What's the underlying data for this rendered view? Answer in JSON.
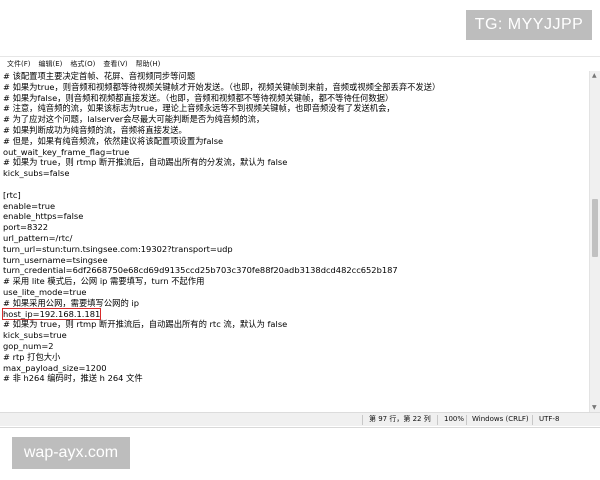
{
  "watermarks": {
    "top": "TG: MYYJJPP",
    "bottom": "wap-ayx.com"
  },
  "menu": [
    "文件(F)",
    "编辑(E)",
    "格式(O)",
    "查看(V)",
    "帮助(H)"
  ],
  "lines": [
    "# 该配置项主要决定首帧、花屏、音视频同步等问题",
    "# 如果为true，则音频和视频都等待视频关键帧才开始发送。（也即，视频关键帧到来前，音频或视频全部丢弃不发送）",
    "# 如果为false，则音频和视频都直接发送。（也即，音频和视频都不等待视频关键帧，都不等待任何数据）",
    "# 注意，纯音频的流，如果该标志为true，理论上音频永远等不到视频关键帧，也即音频没有了发送机会，",
    "# 为了应对这个问题，lalserver会尽最大可能判断是否为纯音频的流，",
    "# 如果判断成功为纯音频的流，音频将直接发送。",
    "# 但是，如果有纯音频流，依然建议将该配置项设置为false",
    "out_wait_key_frame_flag=true",
    "# 如果为 true，则 rtmp 断开推流后，自动踢出所有的分发流，默认为 false",
    "kick_subs=false",
    "",
    "[rtc]",
    "enable=true",
    "enable_https=false",
    "port=8322",
    "url_pattern=/rtc/",
    "turn_url=stun:turn.tsingsee.com:19302?transport=udp",
    "turn_username=tsingsee",
    "turn_credential=6df2668750e68cd69d9135ccd25b703c370fe88f20adb3138dcd482cc652b187",
    "# 采用 lite 模式后，公网 ip 需要填写，turn 不起作用",
    "use_lite_mode=true",
    "# 如果采用公网，需要填写公网的 ip",
    "host_ip=192.168.1.181",
    "# 如果为 true，则 rtmp 断开推流后，自动踢出所有的 rtc 流，默认为 false",
    "kick_subs=true",
    "gop_num=2",
    "# rtp 打包大小",
    "max_payload_size=1200",
    "# 非 h264 编码时，推送 h 264 文件"
  ],
  "highlighted_line_index": 22,
  "status": {
    "position": "第 97 行，第 22 列",
    "zoom": "100%",
    "line_ending": "Windows (CRLF)",
    "encoding": "UTF-8"
  },
  "colors": {
    "highlight_box": "#d62b2b",
    "watermark_bg": "#bdbdbd"
  }
}
